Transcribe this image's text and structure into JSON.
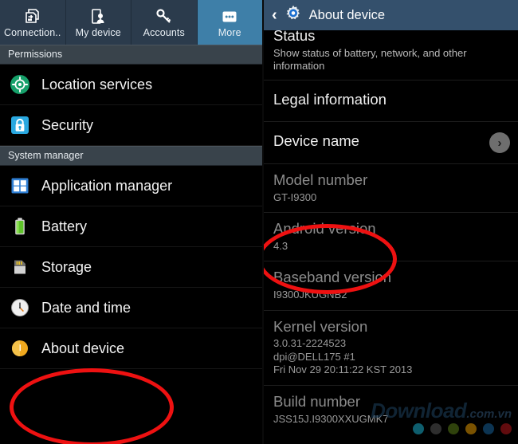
{
  "left_panel": {
    "tabs": [
      {
        "label": "Connection..",
        "icon": "connections-icon",
        "active": false
      },
      {
        "label": "My device",
        "icon": "my-device-icon",
        "active": false
      },
      {
        "label": "Accounts",
        "icon": "accounts-key-icon",
        "active": false
      },
      {
        "label": "More",
        "icon": "more-dots-icon",
        "active": true
      }
    ],
    "sections": [
      {
        "header": "Permissions",
        "items": [
          {
            "label": "Location services",
            "icon": "location-services-icon"
          },
          {
            "label": "Security",
            "icon": "security-lock-icon"
          }
        ]
      },
      {
        "header": "System manager",
        "items": [
          {
            "label": "Application manager",
            "icon": "application-manager-icon"
          },
          {
            "label": "Battery",
            "icon": "battery-icon"
          },
          {
            "label": "Storage",
            "icon": "storage-sdcard-icon"
          },
          {
            "label": "Date and time",
            "icon": "clock-icon"
          },
          {
            "label": "About device",
            "icon": "about-device-icon"
          }
        ]
      }
    ]
  },
  "right_panel": {
    "header": {
      "back": "‹",
      "icon": "settings-gear-icon",
      "title": "About device"
    },
    "items": [
      {
        "title": "Status",
        "subtitle": "Show status of battery, network, and other information",
        "dim": false,
        "sub_bright": true,
        "chevron": false
      },
      {
        "title": "Legal information",
        "subtitle": "",
        "dim": false,
        "sub_bright": false,
        "chevron": false
      },
      {
        "title": "Device name",
        "subtitle": "",
        "dim": false,
        "sub_bright": false,
        "chevron": true,
        "chevron_glyph": "›"
      },
      {
        "title": "Model number",
        "subtitle": "GT-I9300",
        "dim": true,
        "sub_bright": false,
        "chevron": false
      },
      {
        "title": "Android version",
        "subtitle": "4.3",
        "dim": true,
        "sub_bright": false,
        "chevron": false
      },
      {
        "title": "Baseband version",
        "subtitle": "I9300JKUGNB2",
        "dim": true,
        "sub_bright": false,
        "chevron": false
      },
      {
        "title": "Kernel version",
        "subtitle": "3.0.31-2224523\ndpi@DELL175 #1\nFri Nov 29 20:11:22 KST 2013",
        "dim": true,
        "sub_bright": false,
        "chevron": false
      },
      {
        "title": "Build number",
        "subtitle": "JSS15J.I9300XXUGMK7",
        "dim": true,
        "sub_bright": false,
        "chevron": false
      }
    ]
  },
  "annotations": {
    "color": "#ee1111",
    "about_device_ellipse": {
      "label": "about-device-highlight"
    },
    "android_version_ellipse": {
      "label": "android-version-highlight"
    }
  },
  "watermark": {
    "text_main": "Download",
    "text_suffix": ".com.vn",
    "dot_colors": [
      "#13798d",
      "#3c3c3c",
      "#3d5510",
      "#9d6a00",
      "#10436a",
      "#7d0f12"
    ]
  }
}
